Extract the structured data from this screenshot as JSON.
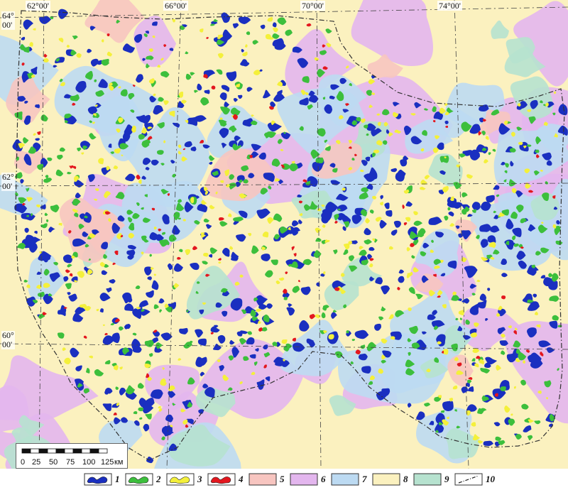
{
  "map": {
    "longitude_labels": [
      "62°00'",
      "66°00'",
      "70°00'",
      "74°00'"
    ],
    "latitude_labels": [
      {
        "deg": "64°",
        "min": "00'"
      },
      {
        "deg": "62°",
        "min": "00'"
      },
      {
        "deg": "60°",
        "min": "00'"
      }
    ]
  },
  "scale": {
    "ticks": [
      "0",
      "25",
      "50",
      "75",
      "100",
      "125"
    ],
    "unit": "км"
  },
  "legend": {
    "items": [
      {
        "num": "1",
        "color": "#1a2fc0",
        "kind": "blob"
      },
      {
        "num": "2",
        "color": "#3cbf3c",
        "kind": "blob"
      },
      {
        "num": "3",
        "color": "#f4f03a",
        "kind": "blob"
      },
      {
        "num": "4",
        "color": "#e3171e",
        "kind": "blob"
      },
      {
        "num": "5",
        "color": "#f7c5c0",
        "kind": "box"
      },
      {
        "num": "6",
        "color": "#e3b6ee",
        "kind": "box"
      },
      {
        "num": "7",
        "color": "#bcdaf2",
        "kind": "box"
      },
      {
        "num": "8",
        "color": "#fbf1bf",
        "kind": "box"
      },
      {
        "num": "9",
        "color": "#b6e2cf",
        "kind": "box"
      },
      {
        "num": "10",
        "color": "#222222",
        "kind": "line"
      }
    ]
  }
}
